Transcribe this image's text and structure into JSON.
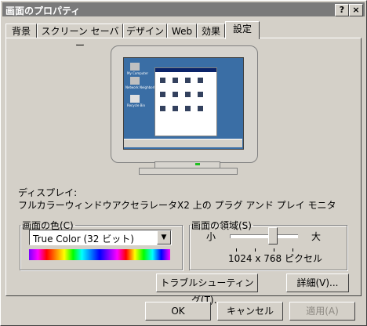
{
  "window": {
    "title": "画面のプロパティ",
    "help_button": "?",
    "close_button": "×"
  },
  "tabs": [
    {
      "label": "背景",
      "active": false
    },
    {
      "label": "スクリーン セーバー",
      "active": false
    },
    {
      "label": "デザイン",
      "active": false
    },
    {
      "label": "Web",
      "active": false
    },
    {
      "label": "効果",
      "active": false
    },
    {
      "label": "設定",
      "active": true
    }
  ],
  "preview": {
    "desktop_icons": [
      "My Computer",
      "Network Neighborhood",
      "Recycle Bin"
    ],
    "screen_color": "#3a6ea5"
  },
  "display": {
    "label": "ディスプレイ:",
    "value": "フルカラーウィンドウアクセラレータX2 上の プラグ アンド プレイ モニタ"
  },
  "colors": {
    "group_label": "画面の色(C)",
    "selected": "True Color (32 ビット)"
  },
  "screen_area": {
    "group_label": "画面の領域(S)",
    "min_label": "小",
    "max_label": "大",
    "resolution": "1024 x 768 ピクセル",
    "slider_position": 0.65
  },
  "buttons": {
    "troubleshoot": "トラブルシューティング(T)...",
    "advanced": "詳細(V)...",
    "ok": "OK",
    "cancel": "キャンセル",
    "apply": "適用(A)"
  }
}
